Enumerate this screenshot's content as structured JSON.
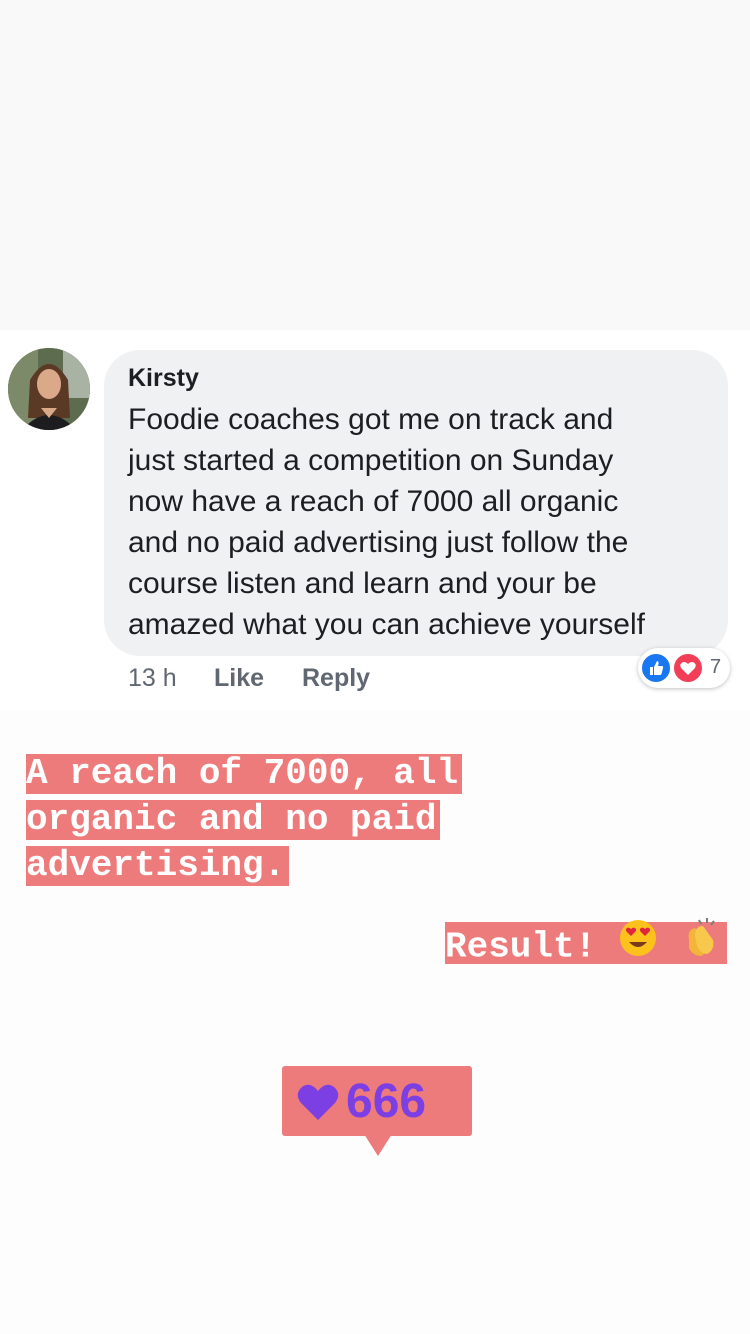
{
  "comment": {
    "author": "Kirsty",
    "lines": [
      "Foodie coaches got me on track and",
      "just started a competition on Sunday",
      "now have a reach of 7000 all organic",
      "and no paid advertising just follow the",
      "course listen and learn and your be",
      "amazed what you can achieve yourself"
    ],
    "time": "13 h",
    "like_label": "Like",
    "reply_label": "Reply",
    "reaction_count": "7",
    "reaction_icons": [
      "like-icon",
      "love-icon"
    ]
  },
  "story": {
    "caption_lines": [
      "A reach of 7000, all",
      "organic and no paid",
      "advertising."
    ],
    "result_text": "Result!",
    "result_emojis": [
      "heart-eyes-emoji",
      "clapping-hands-emoji"
    ],
    "like_sticker_count": "666"
  },
  "colors": {
    "caption_bg": "#ee7b7b",
    "sticker_count": "#7b3fe4",
    "bubble_bg": "#f0f1f3",
    "like_blue": "#1877f2",
    "love_red": "#f33e58"
  }
}
